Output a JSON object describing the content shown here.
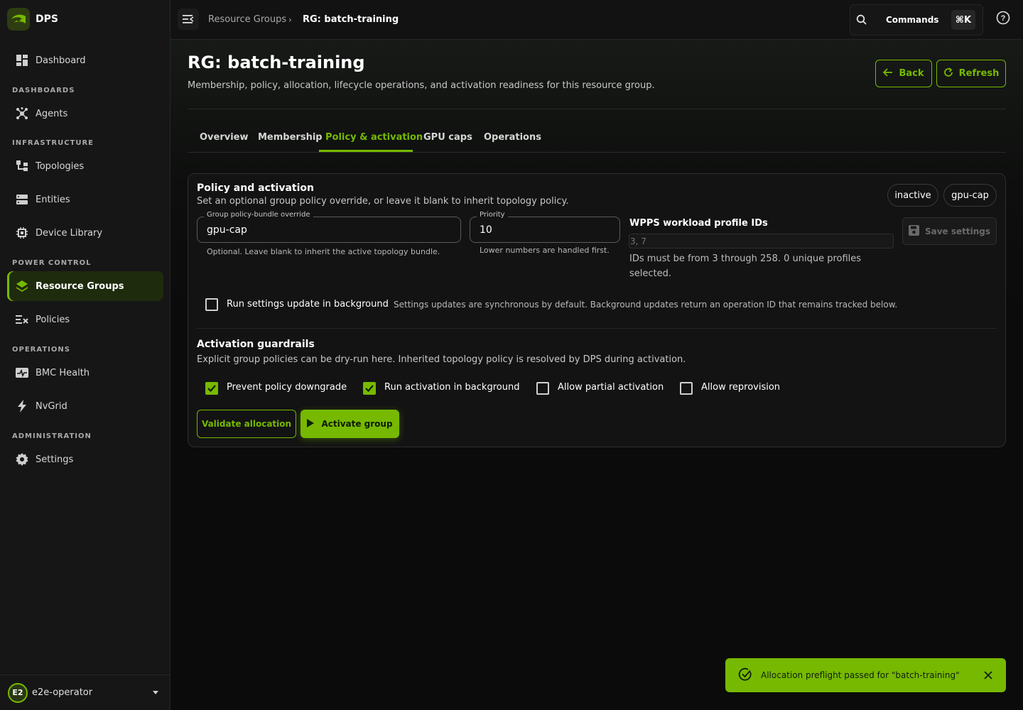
{
  "brand": {
    "name": "DPS"
  },
  "sidebar": {
    "items": [
      {
        "label": "Dashboard",
        "icon": "dashboard-icon"
      },
      {
        "label": "Agents",
        "icon": "agents-icon"
      },
      {
        "label": "Topologies",
        "icon": "topology-icon"
      },
      {
        "label": "Entities",
        "icon": "entities-icon"
      },
      {
        "label": "Device Library",
        "icon": "chip-icon"
      },
      {
        "label": "Resource Groups",
        "icon": "layers-icon",
        "active": true
      },
      {
        "label": "Policies",
        "icon": "policies-icon"
      },
      {
        "label": "BMC Health",
        "icon": "health-icon"
      },
      {
        "label": "NvGrid",
        "icon": "bolt-icon"
      },
      {
        "label": "Settings",
        "icon": "gear-icon"
      }
    ],
    "sections": [
      "DASHBOARDS",
      "INFRASTRUCTURE",
      "POWER CONTROL",
      "OPERATIONS",
      "ADMINISTRATION"
    ],
    "user": {
      "initials": "E2",
      "name": "e2e-operator"
    }
  },
  "topbar": {
    "breadcrumb": [
      "Resource Groups",
      "RG: batch-training"
    ],
    "commands_label": "Commands",
    "shortcut": "⌘K"
  },
  "page": {
    "title": "RG: batch-training",
    "subtitle": "Membership, policy, allocation, lifecycle operations, and activation readiness for this resource group.",
    "back_label": "Back",
    "refresh_label": "Refresh",
    "tabs": [
      "Overview",
      "Membership",
      "Policy & activation",
      "GPU caps",
      "Operations"
    ],
    "active_tab": "Policy & activation"
  },
  "policy": {
    "heading": "Policy and activation",
    "description": "Set an optional group policy override, or leave it blank to inherit topology policy.",
    "chips": [
      "inactive",
      "gpu-cap"
    ],
    "override_legend": "Group policy-bundle override",
    "override_value": "gpu-cap",
    "override_help": "Optional. Leave blank to inherit the active topology bundle.",
    "priority_legend": "Priority",
    "priority_value": "10",
    "priority_help": "Lower numbers are handled first.",
    "wpps_label": "WPPS workload profile IDs",
    "wpps_placeholder": "3, 7",
    "wpps_help": "IDs must be from 3 through 258. 0 unique profiles selected.",
    "save_label": "Save settings",
    "bg_label": "Run settings update in background",
    "bg_checked": false,
    "bg_desc": "Settings updates are synchronous by default. Background updates return an operation ID that remains tracked below."
  },
  "guardrails": {
    "heading": "Activation guardrails",
    "description": "Explicit group policies can be dry-run here. Inherited topology policy is resolved by DPS during activation.",
    "options": [
      {
        "label": "Prevent policy downgrade",
        "checked": true
      },
      {
        "label": "Run activation in background",
        "checked": true
      },
      {
        "label": "Allow partial activation",
        "checked": false
      },
      {
        "label": "Allow reprovision",
        "checked": false
      }
    ],
    "validate_label": "Validate allocation",
    "activate_label": "Activate group"
  },
  "toast": {
    "message": "Allocation preflight passed for \"batch-training\""
  },
  "colors": {
    "accent": "#76b900",
    "bg": "#0b0b0b",
    "sidebar": "#161616"
  }
}
